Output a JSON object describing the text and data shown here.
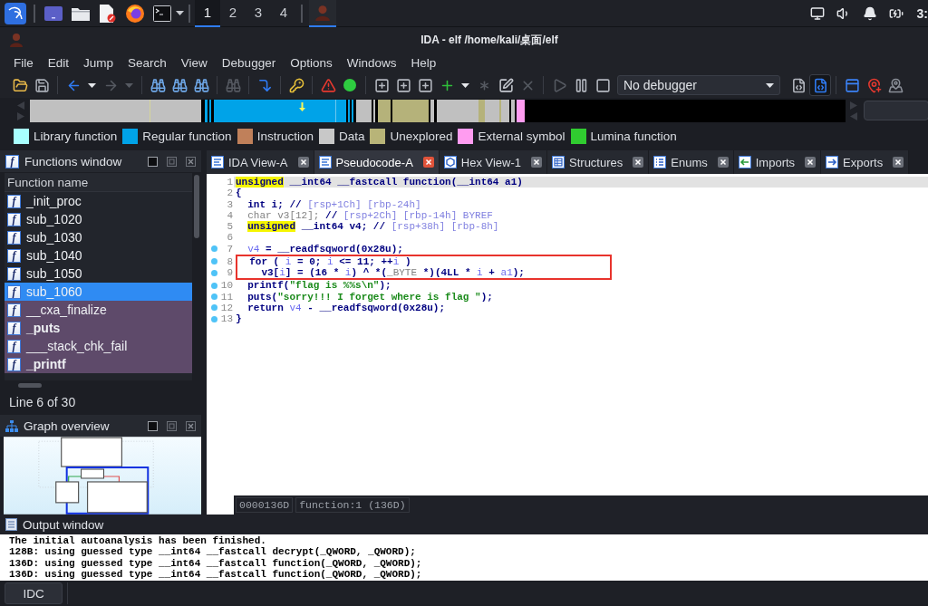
{
  "taskbar": {
    "workspaces": [
      {
        "label": "1",
        "selected": true
      },
      {
        "label": "2",
        "selected": false
      },
      {
        "label": "3",
        "selected": false
      },
      {
        "label": "4",
        "selected": false
      }
    ],
    "tasks": [
      {
        "selected": true
      }
    ],
    "clock": "3:"
  },
  "window": {
    "title": "IDA - elf /home/kali/桌面/elf"
  },
  "menu": [
    "File",
    "Edit",
    "Jump",
    "Search",
    "View",
    "Debugger",
    "Options",
    "Windows",
    "Help"
  ],
  "toolbar": [
    {
      "buttons": [
        {
          "kind": "open",
          "disabled": false,
          "pressed": false
        },
        {
          "kind": "save",
          "disabled": false,
          "pressed": false
        }
      ]
    },
    {
      "buttons": [
        {
          "kind": "back",
          "disabled": false,
          "pressed": false
        },
        {
          "kind": "caret",
          "disabled": false,
          "pressed": false
        },
        {
          "kind": "forward",
          "disabled": true,
          "pressed": false
        },
        {
          "kind": "caret",
          "disabled": true,
          "pressed": false
        }
      ]
    },
    {
      "buttons": [
        {
          "kind": "binoculars",
          "disabled": false,
          "pressed": false
        },
        {
          "kind": "binoculars",
          "disabled": false,
          "pressed": false
        },
        {
          "kind": "binoculars",
          "disabled": false,
          "pressed": false
        }
      ]
    },
    {
      "buttons": [
        {
          "kind": "binoculars",
          "disabled": true,
          "pressed": false
        }
      ]
    },
    {
      "buttons": [
        {
          "kind": "jump",
          "disabled": false,
          "pressed": false
        }
      ]
    },
    {
      "buttons": [
        {
          "kind": "key",
          "disabled": false,
          "pressed": false
        }
      ]
    },
    {
      "buttons": [
        {
          "kind": "warning",
          "disabled": false,
          "pressed": false
        },
        {
          "kind": "dot",
          "disabled": false,
          "pressed": false
        }
      ]
    },
    {
      "buttons": [
        {
          "kind": "add",
          "disabled": false,
          "pressed": false
        },
        {
          "kind": "add",
          "disabled": false,
          "pressed": false
        },
        {
          "kind": "add",
          "disabled": false,
          "pressed": false
        },
        {
          "kind": "plus",
          "disabled": false,
          "pressed": false
        },
        {
          "kind": "caret",
          "disabled": false,
          "pressed": false
        },
        {
          "kind": "asterisk",
          "disabled": true,
          "pressed": false
        },
        {
          "kind": "edit",
          "disabled": false,
          "pressed": false
        },
        {
          "kind": "cross",
          "disabled": true,
          "pressed": false
        }
      ]
    },
    {
      "buttons": [
        {
          "kind": "play",
          "disabled": true,
          "pressed": false
        },
        {
          "kind": "pause",
          "disabled": false,
          "pressed": false
        },
        {
          "kind": "stop",
          "disabled": false,
          "pressed": false
        },
        {
          "kind": "select",
          "value": "No debugger",
          "disabled": false,
          "pressed": false
        },
        {
          "kind": "attach",
          "disabled": false,
          "pressed": false
        },
        {
          "kind": "run",
          "disabled": false,
          "pressed": true
        }
      ]
    },
    {
      "buttons": [
        {
          "kind": "panel",
          "disabled": false,
          "pressed": false
        },
        {
          "kind": "pin",
          "disabled": false,
          "pressed": false
        },
        {
          "kind": "pins",
          "disabled": false,
          "pressed": false
        }
      ]
    }
  ],
  "legend": [
    {
      "label": "Library function",
      "color": "#a8ffff"
    },
    {
      "label": "Regular function",
      "color": "#00a3e8"
    },
    {
      "label": "Instruction",
      "color": "#c0805a"
    },
    {
      "label": "Data",
      "color": "#c8c8c8"
    },
    {
      "label": "Unexplored",
      "color": "#b8b478"
    },
    {
      "label": "External symbol",
      "color": "#ff9cf0"
    },
    {
      "label": "Lumina function",
      "color": "#30cc30"
    }
  ],
  "functions_window": {
    "title": "Functions window",
    "icon": "f",
    "column": "Function name",
    "items": [
      {
        "icon": "f",
        "name": "_init_proc",
        "kind": "regular",
        "bold": false,
        "selected": false
      },
      {
        "icon": "f",
        "name": "sub_1020",
        "kind": "regular",
        "bold": false,
        "selected": false
      },
      {
        "icon": "f",
        "name": "sub_1030",
        "kind": "regular",
        "bold": false,
        "selected": false
      },
      {
        "icon": "f",
        "name": "sub_1040",
        "kind": "regular",
        "bold": false,
        "selected": false
      },
      {
        "icon": "f",
        "name": "sub_1050",
        "kind": "regular",
        "bold": false,
        "selected": false
      },
      {
        "icon": "f",
        "name": "sub_1060",
        "kind": "regular",
        "bold": false,
        "selected": true
      },
      {
        "icon": "f",
        "name": "__cxa_finalize",
        "kind": "external",
        "bold": false,
        "selected": false
      },
      {
        "icon": "f",
        "name": "_puts",
        "kind": "external",
        "bold": true,
        "selected": false
      },
      {
        "icon": "f",
        "name": "___stack_chk_fail",
        "kind": "external",
        "bold": false,
        "selected": false
      },
      {
        "icon": "f",
        "name": "_printf",
        "kind": "external",
        "bold": true,
        "selected": false
      }
    ],
    "status": "Line 6 of 30"
  },
  "graph_overview": {
    "title": "Graph overview"
  },
  "tabs": [
    {
      "label": "IDA View-A",
      "kind": "disassembly",
      "selected": false
    },
    {
      "label": "Pseudocode-A",
      "kind": "pseudocode",
      "selected": true
    },
    {
      "label": "Hex View-1",
      "kind": "hex",
      "selected": false
    },
    {
      "label": "Structures",
      "kind": "structures",
      "selected": false
    },
    {
      "label": "Enums",
      "kind": "enums",
      "selected": false
    },
    {
      "label": "Imports",
      "kind": "imports",
      "selected": false
    },
    {
      "label": "Exports",
      "kind": "exports",
      "selected": false
    }
  ],
  "pseudocode": {
    "lines": [
      {
        "kind": "line",
        "number": "1",
        "marked": false,
        "current": true,
        "tokens": [
          {
            "kind": "highlight",
            "text": "unsigned"
          },
          {
            "kind": "plain",
            "text": " __int64 __fastcall function(__int64 a1)"
          }
        ]
      },
      {
        "kind": "line",
        "number": "2",
        "marked": false,
        "current": false,
        "tokens": [
          {
            "kind": "plain",
            "text": "{"
          }
        ]
      },
      {
        "kind": "line",
        "number": "3",
        "marked": false,
        "current": false,
        "tokens": [
          {
            "kind": "plain",
            "text": "  int i; // "
          },
          {
            "kind": "comment",
            "text": "[rsp+1Ch] [rbp-24h]"
          }
        ]
      },
      {
        "kind": "line",
        "number": "4",
        "marked": false,
        "current": false,
        "tokens": [
          {
            "kind": "greyed",
            "text": "  char v3[12]; "
          },
          {
            "kind": "plain",
            "text": "// "
          },
          {
            "kind": "comment",
            "text": "[rsp+2Ch] [rbp-14h] BYREF"
          }
        ]
      },
      {
        "kind": "line",
        "number": "5",
        "marked": false,
        "current": false,
        "tokens": [
          {
            "kind": "highlight",
            "text": "  unsigned"
          },
          {
            "kind": "plain",
            "text": " __int64 v4; // "
          },
          {
            "kind": "comment",
            "text": "[rsp+38h] [rbp-8h]"
          }
        ]
      },
      {
        "kind": "line",
        "number": "6",
        "marked": false,
        "current": false
      },
      {
        "kind": "line",
        "number": "7",
        "marked": true,
        "current": false,
        "tokens": [
          {
            "kind": "variable",
            "text": "  v4"
          },
          {
            "kind": "plain",
            "text": " = __readfsqword(0x28u);"
          }
        ]
      },
      {
        "kind": "annotation",
        "lines": [
          {
            "number": "8",
            "marked": true,
            "current": false,
            "tokens": [
              {
                "kind": "plain",
                "text": "  for ( "
              },
              {
                "kind": "variable",
                "text": "i"
              },
              {
                "kind": "plain",
                "text": " = 0; "
              },
              {
                "kind": "variable",
                "text": "i"
              },
              {
                "kind": "plain",
                "text": " <= 11; ++"
              },
              {
                "kind": "variable",
                "text": "i"
              },
              {
                "kind": "plain",
                "text": " )"
              }
            ]
          },
          {
            "number": "9",
            "marked": true,
            "current": false,
            "tokens": [
              {
                "kind": "plain",
                "text": "    v3["
              },
              {
                "kind": "variable",
                "text": "i"
              },
              {
                "kind": "plain",
                "text": "] = (16 * "
              },
              {
                "kind": "variable",
                "text": "i"
              },
              {
                "kind": "plain",
                "text": ") ^ *("
              },
              {
                "kind": "greyed",
                "text": "_BYTE"
              },
              {
                "kind": "plain",
                "text": " *)(4LL * "
              },
              {
                "kind": "variable",
                "text": "i"
              },
              {
                "kind": "plain",
                "text": " + "
              },
              {
                "kind": "variable",
                "text": "a1"
              },
              {
                "kind": "plain",
                "text": ");"
              }
            ]
          }
        ]
      },
      {
        "kind": "line",
        "number": "10",
        "marked": true,
        "current": false,
        "tokens": [
          {
            "kind": "plain",
            "text": "  printf("
          },
          {
            "kind": "string",
            "text": "\"flag is %%s\\n\""
          },
          {
            "kind": "plain",
            "text": ");"
          }
        ]
      },
      {
        "kind": "line",
        "number": "11",
        "marked": true,
        "current": false,
        "tokens": [
          {
            "kind": "plain",
            "text": "  puts("
          },
          {
            "kind": "string",
            "text": "\"sorry!!! I forget where is flag \""
          },
          {
            "kind": "plain",
            "text": ");"
          }
        ]
      },
      {
        "kind": "line",
        "number": "12",
        "marked": true,
        "current": false,
        "tokens": [
          {
            "kind": "plain",
            "text": "  return "
          },
          {
            "kind": "variable",
            "text": "v4"
          },
          {
            "kind": "plain",
            "text": " - __readfsqword(0x28u);"
          }
        ]
      },
      {
        "kind": "line",
        "number": "13",
        "marked": true,
        "current": false,
        "tokens": [
          {
            "kind": "plain",
            "text": "}"
          }
        ]
      }
    ],
    "status": [
      "0000136D",
      "function:1 (136D)"
    ]
  },
  "output_window": {
    "title": "Output window",
    "lines": [
      "The initial autoanalysis has been finished.",
      "128B: using guessed type __int64 __fastcall decrypt(_QWORD, _QWORD);",
      "136D: using guessed type __int64 __fastcall function(_QWORD, _QWORD);",
      "136D: using guessed type __int64 __fastcall function(_QWORD, _QWORD);"
    ]
  },
  "command_bar": {
    "language": "IDC"
  }
}
